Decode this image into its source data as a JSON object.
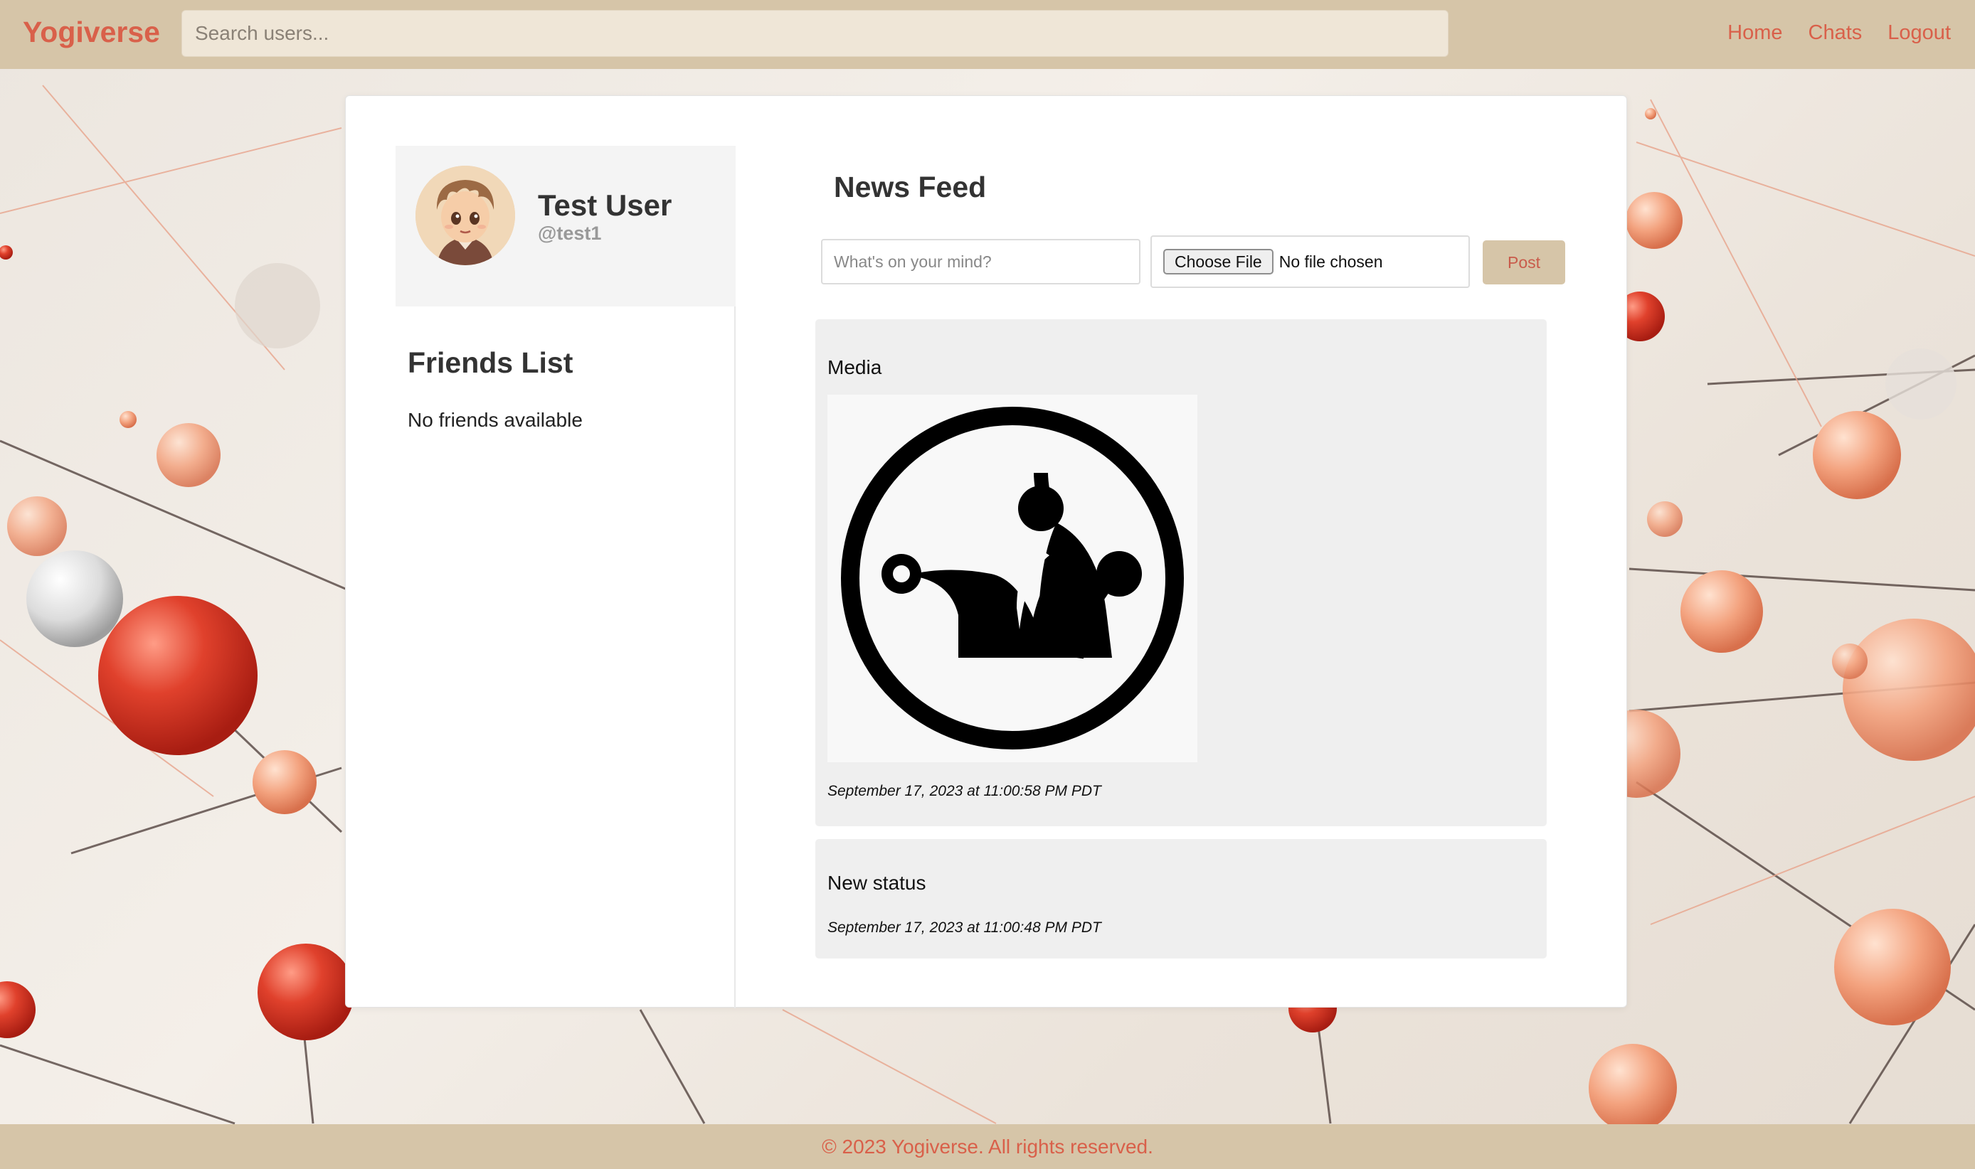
{
  "header": {
    "brand": "Yogiverse",
    "search_placeholder": "Search users...",
    "nav": [
      "Home",
      "Chats",
      "Logout"
    ]
  },
  "profile": {
    "name": "Test User",
    "handle": "@test1"
  },
  "friends": {
    "title": "Friends List",
    "empty_text": "No friends available"
  },
  "feed": {
    "title": "News Feed",
    "status_placeholder": "What's on your mind?",
    "file_button": "Choose File",
    "file_status": "No file chosen",
    "post_button": "Post",
    "posts": [
      {
        "text": "Media",
        "time": "September 17, 2023 at 11:00:58 PM PDT"
      },
      {
        "text": "New status",
        "time": "September 17, 2023 at 11:00:48 PM PDT"
      }
    ]
  },
  "footer": {
    "text": "© 2023 Yogiverse. All rights reserved."
  },
  "colors": {
    "accent": "#d9604a",
    "bar": "#d6c5a8"
  }
}
